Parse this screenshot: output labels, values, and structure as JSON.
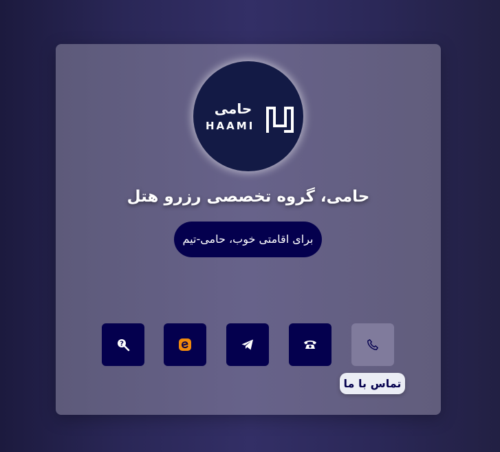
{
  "brand": {
    "logo_text_fa": "حامی",
    "logo_text_en": "HAAMI"
  },
  "header": {
    "title": "حامی، گروه تخصصی رزرو هتل"
  },
  "tagline": {
    "text": "برای اقامتی خوب، حامی-تیم"
  },
  "social_links": [
    {
      "icon": "search-help-icon"
    },
    {
      "icon": "eitaa-icon",
      "color": "#f08a0c"
    },
    {
      "icon": "telegram-icon"
    },
    {
      "icon": "telephone-icon"
    },
    {
      "icon": "phone-call-icon",
      "active": true
    }
  ],
  "tooltip": {
    "text": "تماس با ما"
  },
  "colors": {
    "accent": "#04004e",
    "logo_background": "#131a45",
    "active_button": "#807b9c",
    "tooltip_background": "#ebedf5"
  }
}
